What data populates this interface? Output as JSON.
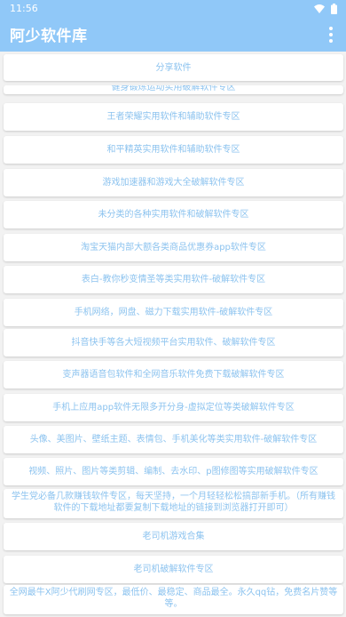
{
  "status_bar": {
    "time": "11:56",
    "icons": [
      "wifi-icon",
      "battery-icon"
    ]
  },
  "app_bar": {
    "title": "阿少软件库",
    "menu_icon": "more-vert-icon"
  },
  "colors": {
    "primary": "#90c8f8",
    "item_text": "#8cc3ef",
    "background": "#f2f2f2"
  },
  "items": [
    "分享软件",
    "健身锻炼运动实用破解软件专区",
    "王者荣耀实用软件和辅助软件专区",
    "和平精英实用软件和辅助软件专区",
    "游戏加速器和游戏大全破解软件专区",
    "未分类的各种实用软件和破解软件专区",
    "淘宝天猫内部大额各类商品优惠券app软件专区",
    "表白-教你秒变情圣等类实用软件-破解软件专区",
    "手机网络，网盘、磁力下载实用软件-破解软件专区",
    "抖音快手等各大短视频平台实用软件、破解软件专区",
    "变声器语音包软件和全网音乐软件免费下载破解软件专区",
    "手机上应用app软件无限多开分身-虚拟定位等类破解软件专区",
    "头像、美图片、壁纸主题、表情包、手机美化等类实用软件-破解软件专区",
    "视频、照片、图片等类剪辑、编制、去水印、p图修图等实用破解软件专区",
    "学生党必备几款赚钱软件专区，每天坚持，一个月轻轻松松搞部新手机。（所有赚钱软件的下载地址都要复制下载地址的链接到浏览器打开即可）",
    "老司机游戏合集",
    "老司机破解软件专区",
    "全网最牛X阿少代刷网专区，最低价、最稳定、商品最全。永久qq钻，免费名片赞等等。"
  ]
}
